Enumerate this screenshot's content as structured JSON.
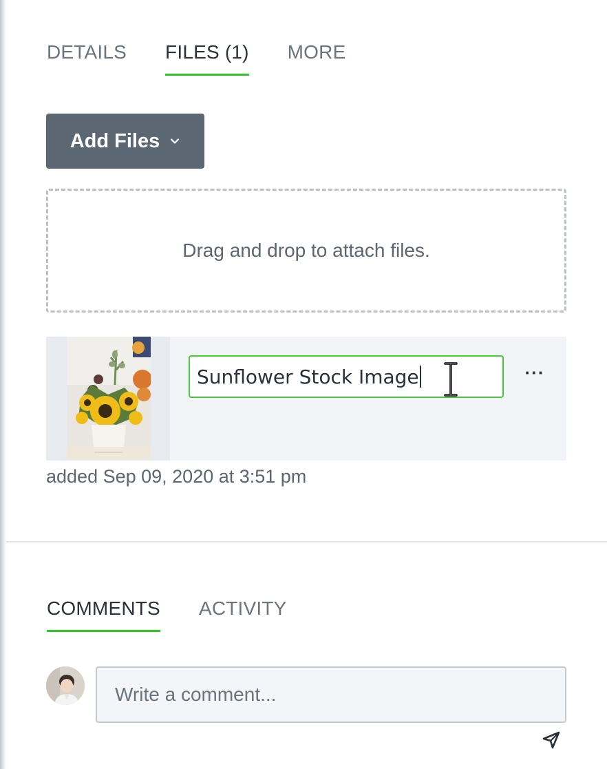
{
  "tabs": [
    {
      "label": "DETAILS",
      "active": false
    },
    {
      "label": "FILES (1)",
      "active": true
    },
    {
      "label": "MORE",
      "active": false
    }
  ],
  "add_files": {
    "label": "Add Files",
    "icon": "chevron-down-icon"
  },
  "dropzone": {
    "text": "Drag and drop to attach files."
  },
  "file": {
    "name": "Sunflower Stock Image",
    "added": "added Sep 09, 2020 at 3:51 pm",
    "menu_label": "···"
  },
  "comments_tabs": [
    {
      "label": "COMMENTS",
      "active": true
    },
    {
      "label": "ACTIVITY",
      "active": false
    }
  ],
  "comment": {
    "placeholder": "Write a comment..."
  },
  "colors": {
    "accent": "#35c42a",
    "button_bg": "#5b6773",
    "input_focus": "#48c938"
  }
}
